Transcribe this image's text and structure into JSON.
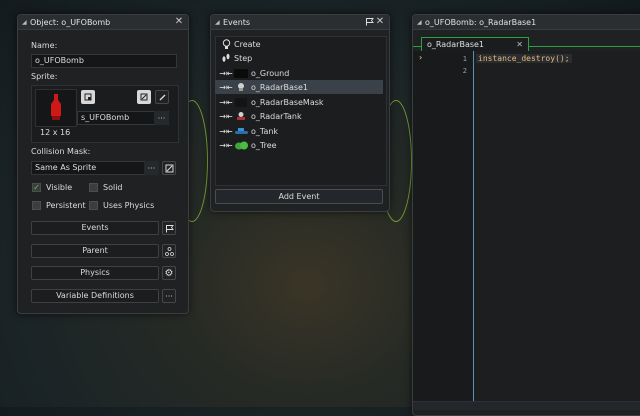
{
  "object_panel": {
    "title": "Object: o_UFOBomb",
    "name_label": "Name:",
    "name_value": "o_UFOBomb",
    "sprite_label": "Sprite:",
    "sprite_size": "12 x 16",
    "sprite_name": "s_UFOBomb",
    "collision_label": "Collision Mask:",
    "collision_value": "Same As Sprite",
    "visible_label": "Visible",
    "solid_label": "Solid",
    "persistent_label": "Persistent",
    "uses_physics_label": "Uses Physics",
    "events_button": "Events",
    "parent_button": "Parent",
    "physics_button": "Physics",
    "variables_button": "Variable Definitions",
    "more_label": "···"
  },
  "events_panel": {
    "title": "Events",
    "items": [
      {
        "label": "Create",
        "icon": "bulb-icon"
      },
      {
        "label": "Step",
        "icon": "footsteps-icon"
      },
      {
        "label": "o_Ground",
        "icon": "collision-icon"
      },
      {
        "label": "o_RadarBase1",
        "icon": "collision-icon"
      },
      {
        "label": "o_RadarBaseMask",
        "icon": "collision-icon"
      },
      {
        "label": "o_RadarTank",
        "icon": "collision-icon"
      },
      {
        "label": "o_Tank",
        "icon": "collision-icon"
      },
      {
        "label": "o_Tree",
        "icon": "collision-icon"
      }
    ],
    "add_event_button": "Add Event"
  },
  "code_panel": {
    "title": "o_UFOBomb: o_RadarBase1",
    "tab_label": "o_RadarBase1",
    "line_numbers": [
      "1",
      "2"
    ],
    "code_text": "instance_destroy();"
  },
  "colors": {
    "accent_green": "#7aa133",
    "panel_bg": "#1f2123",
    "selection": "#3a4148"
  }
}
